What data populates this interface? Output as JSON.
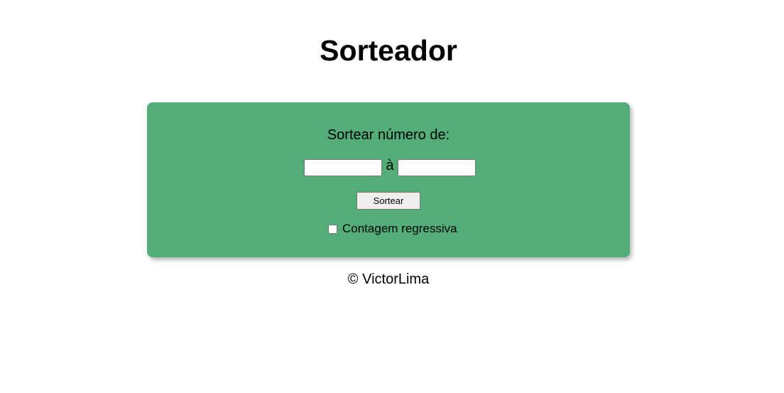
{
  "page": {
    "title": "Sorteador"
  },
  "card": {
    "prompt": "Sortear número de:",
    "from_input": {
      "value": "",
      "placeholder": ""
    },
    "separator": "à",
    "to_input": {
      "value": "",
      "placeholder": ""
    },
    "draw_button_label": "Sortear",
    "countdown": {
      "label": "Contagem regressiva",
      "checked": false
    },
    "background_color": "#52ad79"
  },
  "footer": {
    "text": "© VictorLima"
  }
}
